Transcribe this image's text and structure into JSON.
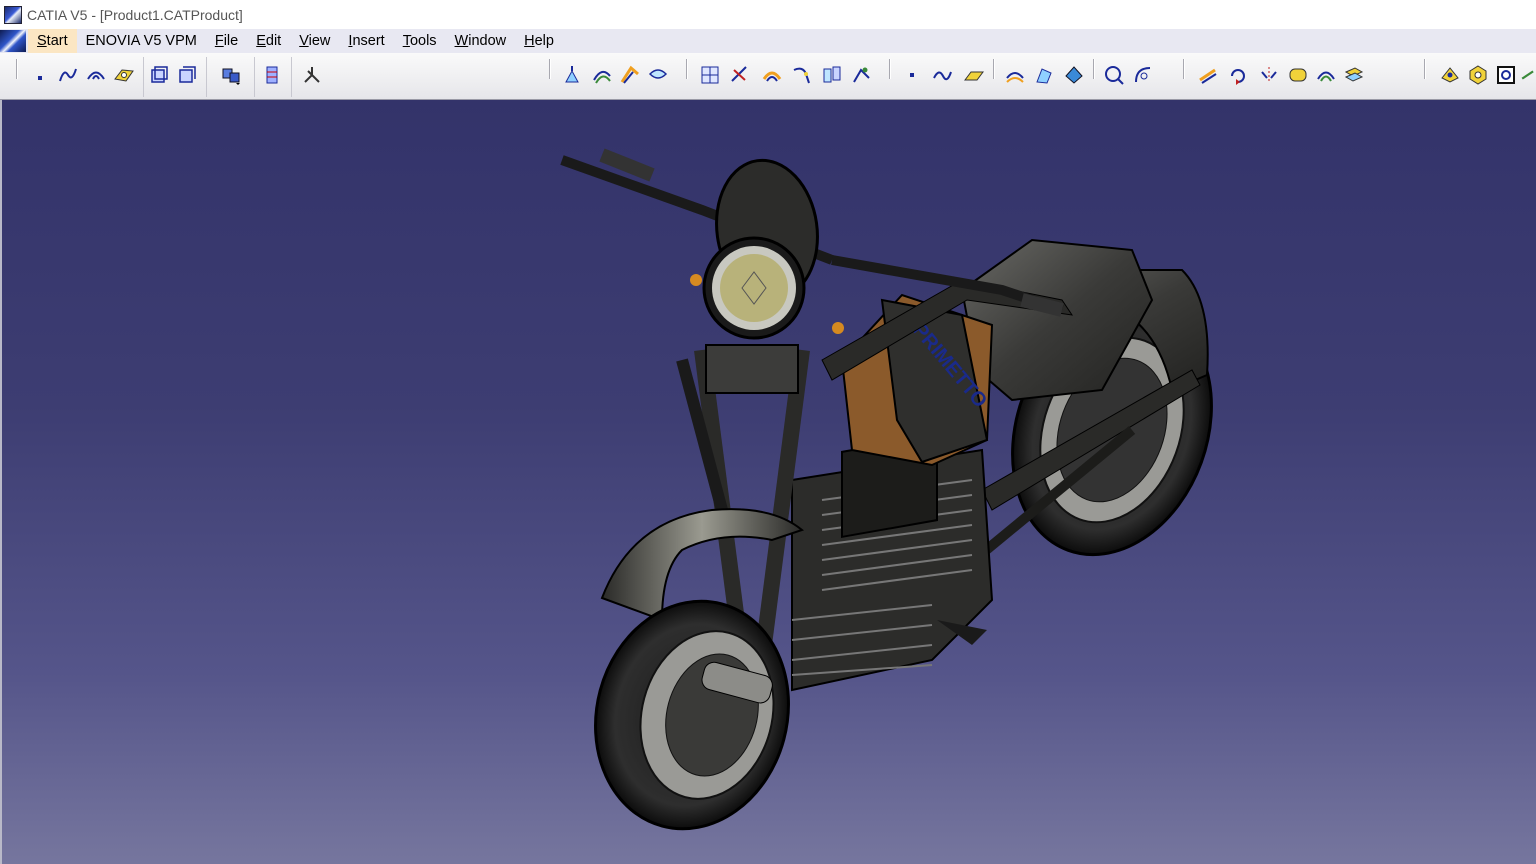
{
  "window": {
    "title": "CATIA V5 - [Product1.CATProduct]"
  },
  "menu": {
    "items": [
      {
        "label": "Start",
        "underline": "S",
        "rest": "tart",
        "active": true
      },
      {
        "label": "ENOVIA V5 VPM",
        "underline": "",
        "rest": "ENOVIA V5 VPM",
        "active": false
      },
      {
        "label": "File",
        "underline": "F",
        "rest": "ile",
        "active": false
      },
      {
        "label": "Edit",
        "underline": "E",
        "rest": "dit",
        "active": false
      },
      {
        "label": "View",
        "underline": "V",
        "rest": "iew",
        "active": false
      },
      {
        "label": "Insert",
        "underline": "I",
        "rest": "nsert",
        "active": false
      },
      {
        "label": "Tools",
        "underline": "T",
        "rest": "ools",
        "active": false
      },
      {
        "label": "Window",
        "underline": "W",
        "rest": "indow",
        "active": false
      },
      {
        "label": "Help",
        "underline": "H",
        "rest": "elp",
        "active": false
      }
    ]
  },
  "toolbar": {
    "icons": [
      "point-icon",
      "spline-icon",
      "arc-icon",
      "plane-icon",
      "part-body-icon",
      "part-body-alt-icon",
      "assembly-icon",
      "catalog-icon",
      "compass-icon",
      "surface-extrude-icon",
      "surface-revolve-icon",
      "surface-sweep-icon",
      "surface-fill-icon",
      "grid-icon",
      "sketch-icon",
      "offset-icon",
      "join-icon",
      "split-icon",
      "trim-icon",
      "point-tool-icon",
      "curve-tool-icon",
      "plane-tool-icon",
      "blend-icon",
      "loft-icon",
      "extract-icon",
      "circle-icon",
      "corner-icon",
      "transform-icon",
      "rotate-icon",
      "symmetry-icon",
      "scale-icon",
      "affinity-icon",
      "layers-icon",
      "render-icon",
      "material-icon",
      "view-icon",
      "extra-icon"
    ]
  },
  "model": {
    "brand_text": "PRIMETTO",
    "colors": {
      "background_top": "#33336a",
      "background_bottom": "#76769e",
      "body": "#3a3a38",
      "accent": "#8b5a2b",
      "headlight": "#b8b27a"
    }
  }
}
